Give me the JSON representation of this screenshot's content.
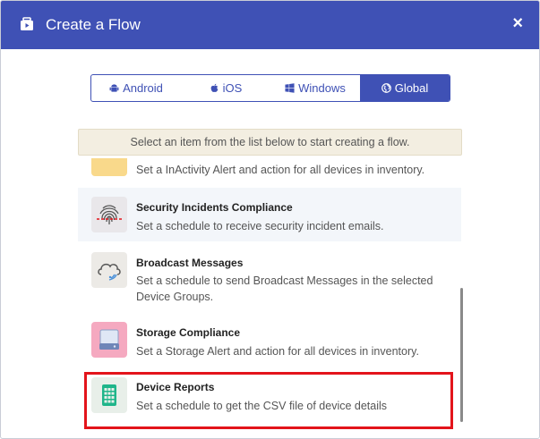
{
  "header": {
    "title": "Create a Flow",
    "close_label": "×"
  },
  "tabs": [
    {
      "label": "Android",
      "icon": "android-icon",
      "active": false
    },
    {
      "label": "iOS",
      "icon": "apple-icon",
      "active": false
    },
    {
      "label": "Windows",
      "icon": "windows-icon",
      "active": false
    },
    {
      "label": "Global",
      "icon": "globe-icon",
      "active": true
    }
  ],
  "hint": "Select an item from the list below to start creating a flow.",
  "items": [
    {
      "name": "",
      "desc": "Set a InActivity Alert and action for all devices in inventory.",
      "icon": "inactivity-icon"
    },
    {
      "name": "Security Incidents Compliance",
      "desc": "Set a schedule to receive security incident emails.",
      "icon": "fingerprint-icon"
    },
    {
      "name": "Broadcast Messages",
      "desc": "Set a schedule to send Broadcast Messages in the selected Device Groups.",
      "icon": "cloud-broadcast-icon"
    },
    {
      "name": "Storage Compliance",
      "desc": "Set a Storage Alert and action for all devices in inventory.",
      "icon": "storage-drive-icon"
    },
    {
      "name": "Device Reports",
      "desc": "Set a schedule to get the CSV file of device details",
      "icon": "spreadsheet-icon"
    }
  ],
  "colors": {
    "primary": "#3f51b5",
    "highlight": "#e3141b",
    "hint_bg": "#f3eee1"
  }
}
